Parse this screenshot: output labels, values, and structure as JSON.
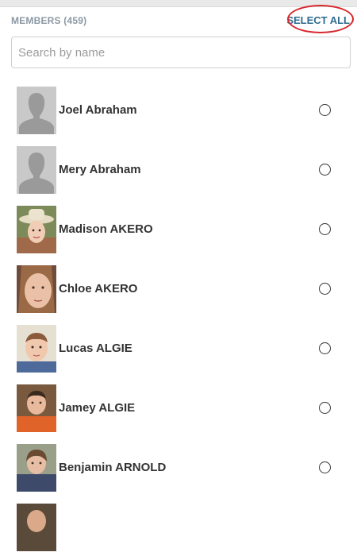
{
  "header": {
    "members_label": "MEMBERS (459)",
    "select_all": "SELECT ALL"
  },
  "search": {
    "placeholder": "Search by name",
    "value": ""
  },
  "members": [
    {
      "name": "Joel Abraham",
      "avatar": "placeholder-silhouette",
      "selected": false
    },
    {
      "name": "Mery Abraham",
      "avatar": "placeholder-silhouette",
      "selected": false
    },
    {
      "name": "Madison AKERO",
      "avatar": "photo",
      "selected": false
    },
    {
      "name": "Chloe AKERO",
      "avatar": "photo",
      "selected": false
    },
    {
      "name": "Lucas ALGIE",
      "avatar": "photo",
      "selected": false
    },
    {
      "name": "Jamey ALGIE",
      "avatar": "photo",
      "selected": false
    },
    {
      "name": "Benjamin ARNOLD",
      "avatar": "photo",
      "selected": false
    }
  ],
  "colors": {
    "accent": "#2f6b8e",
    "highlight": "#d8262a",
    "muted": "#8c98a3"
  }
}
